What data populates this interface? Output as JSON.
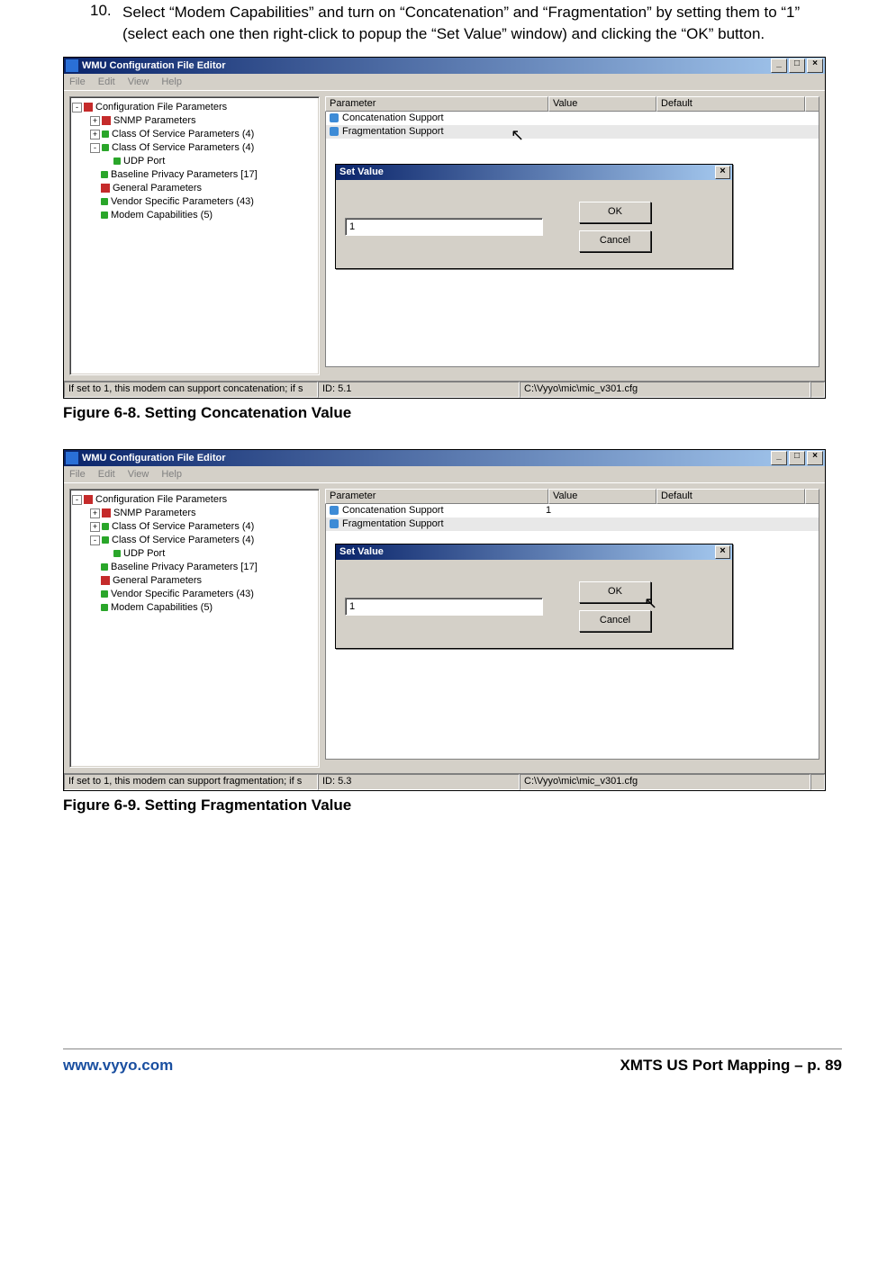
{
  "step": {
    "number": "10.",
    "text": "Select “Modem Capabilities” and turn on “Concatenation” and “Fragmentation” by setting them to “1” (select each one then right-click to popup the “Set Value” window)  and clicking the “OK” button."
  },
  "captions": {
    "fig68": "Figure 6-8. Setting Concatenation Value",
    "fig69": "Figure 6-9. Setting Fragmentation Value"
  },
  "app": {
    "title": "WMU Configuration File Editor",
    "menus": [
      "File",
      "Edit",
      "View",
      "Help"
    ],
    "window_buttons": {
      "min": "_",
      "max": "□",
      "close": "×"
    }
  },
  "tree": {
    "root": "Configuration File Parameters",
    "items": [
      {
        "exp": "+",
        "icon": "red",
        "label": "SNMP Parameters"
      },
      {
        "exp": "+",
        "icon": "grn",
        "label": "Class Of Service Parameters (4)"
      },
      {
        "exp": "-",
        "icon": "grn",
        "label": "Class Of Service Parameters (4)"
      },
      {
        "exp": "",
        "icon": "grn",
        "label": "UDP Port",
        "indent": true
      },
      {
        "exp": "",
        "icon": "grn",
        "label": "Baseline Privacy Parameters [17]"
      },
      {
        "exp": "",
        "icon": "red",
        "label": "General Parameters"
      },
      {
        "exp": "",
        "icon": "grn",
        "label": "Vendor Specific Parameters (43)"
      },
      {
        "exp": "",
        "icon": "grn",
        "label": "Modem Capabilities (5)"
      }
    ]
  },
  "list": {
    "headers": {
      "param": "Parameter",
      "value": "Value",
      "default": "Default"
    }
  },
  "fig68": {
    "rows": [
      {
        "name": "Concatenation Support",
        "value": ""
      },
      {
        "name": "Fragmentation Support",
        "value": ""
      }
    ],
    "dialog": {
      "title": "Set Value",
      "input": "1 ",
      "ok": "OK",
      "cancel": "Cancel"
    },
    "status": {
      "hint": "If set to 1, this modem can support concatenation; if s",
      "id": "ID: 5.1",
      "path": "C:\\Vyyo\\mic\\mic_v301.cfg"
    }
  },
  "fig69": {
    "rows": [
      {
        "name": "Concatenation Support",
        "value": "1"
      },
      {
        "name": "Fragmentation Support",
        "value": ""
      }
    ],
    "dialog": {
      "title": "Set Value",
      "input": "1",
      "ok": "OK",
      "cancel": "Cancel"
    },
    "status": {
      "hint": "If set to 1, this modem can support fragmentation; if s",
      "id": "ID: 5.3",
      "path": "C:\\Vyyo\\mic\\mic_v301.cfg"
    }
  },
  "footer": {
    "url": "www.vyyo.com",
    "right": "XMTS US Port Mapping – p. 89"
  }
}
